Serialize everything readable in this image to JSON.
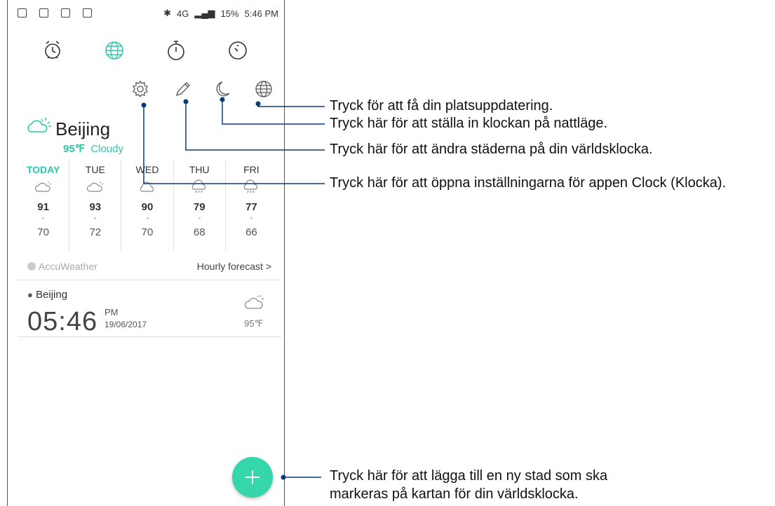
{
  "status_bar": {
    "network": "4G",
    "battery": "15%",
    "time": "5:46 PM"
  },
  "tabs": [
    {
      "icon": "alarm-icon",
      "active": false
    },
    {
      "icon": "globe-icon",
      "active": true
    },
    {
      "icon": "stopwatch-icon",
      "active": false
    },
    {
      "icon": "timer-icon",
      "active": false
    }
  ],
  "toolbar": {
    "icons": [
      "settings-icon",
      "edit-icon",
      "night-mode-icon",
      "globe-icon"
    ]
  },
  "weather": {
    "city": "Beijing",
    "temp": "95℉",
    "condition": "Cloudy",
    "forecast": [
      {
        "day": "TODAY",
        "high": "91",
        "low": "70"
      },
      {
        "day": "TUE",
        "high": "93",
        "low": "72"
      },
      {
        "day": "WED",
        "high": "90",
        "low": "70"
      },
      {
        "day": "THU",
        "high": "79",
        "low": "68"
      },
      {
        "day": "FRI",
        "high": "77",
        "low": "66"
      }
    ],
    "provider": "AccuWeather",
    "hourly_link": "Hourly forecast >"
  },
  "world_clock": {
    "city": "Beijing",
    "time": "05:46",
    "ampm": "PM",
    "date": "19/06/2017",
    "temp": "95℉"
  },
  "callouts": {
    "location_update": "Tryck för att få din platsuppdatering.",
    "night_mode": "Tryck här för att ställa in klockan på nattläge.",
    "edit_cities": "Tryck här för att ändra städerna på din världsklocka.",
    "settings": "Tryck här för att öppna inställningarna för appen Clock (Klocka).",
    "add_city_line1": "Tryck här för att lägga till en ny stad som ska",
    "add_city_line2": "markeras på kartan för din världsklocka."
  },
  "colors": {
    "accent": "#2ec7a9",
    "fab": "#35d6a9",
    "callout_line": "#0b3a75"
  }
}
